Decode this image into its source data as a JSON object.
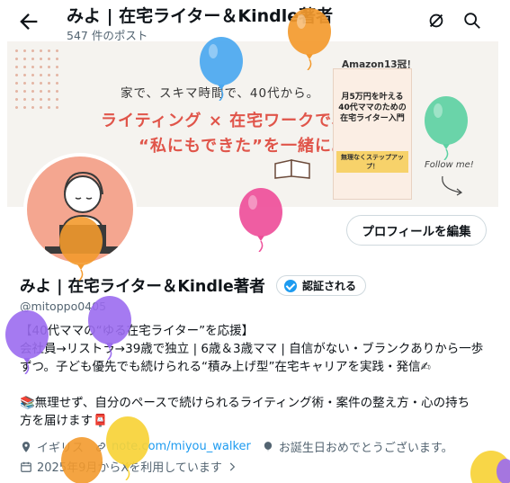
{
  "header": {
    "title": "みよ | 在宅ライター＆Kindle著者",
    "post_count": "547 件のポスト",
    "back_icon": "arrow-left-icon",
    "icons": [
      "analytics-icon",
      "search-icon"
    ]
  },
  "banner": {
    "tagline": "家で、スキマ時間で、40代から。",
    "headline_1": "ライティング × 在宅ワークで、",
    "headline_2": "“私にもできた”を一緒に。",
    "book_badge": "Amazon13冠！",
    "book_title": "月5万円を叶える 40代ママのための 在宅ライター入門",
    "book_band": "無理なくステップアップ！",
    "follow_me": "Follow me!"
  },
  "profile": {
    "edit_button": "プロフィールを編集",
    "display_name": "みよ | 在宅ライター＆Kindle著者",
    "verify_label": "認証される",
    "handle": "@mitoppo0405",
    "bio_lines": [
      "【40代ママの“ゆる在宅ライター”を応援】",
      "会社員→リストラ→39歳で独立 | 6歳＆3歳ママ | 自信がない・ブランクありから一歩",
      "ずつ。子ども優先でも続けられる“積み上げ型”在宅キャリアを実践・発信✍",
      "",
      "📚無理せず、自分のペースで続けられるライティング術・案件の整え方・心の持ち",
      "方を届けます📮"
    ],
    "location": "イギリス",
    "website": "note.com/miyou_walker",
    "birthday": "お誕生日おめでとうございます。",
    "joined": "2025年9月からXを利用しています"
  },
  "colors": {
    "accent": "#1d9bf0",
    "banner_red": "#e0554a",
    "avatar_bg": "#f4a690",
    "balloons": [
      "#4aa8f0",
      "#f39a2e",
      "#5dd1a3",
      "#ee4f9a",
      "#9b6cf0",
      "#f7d237"
    ]
  }
}
